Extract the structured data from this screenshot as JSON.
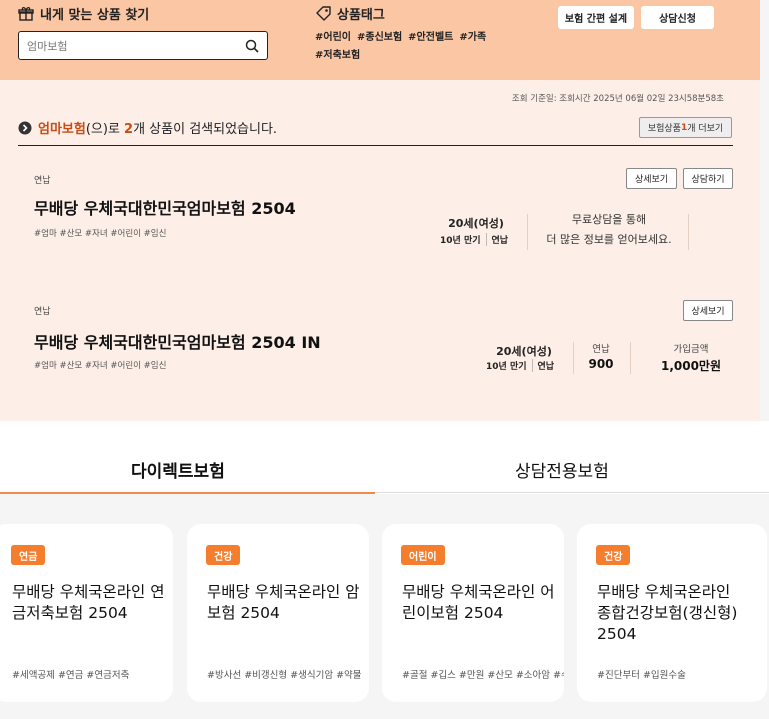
{
  "finder": {
    "title": "내게 맞는 상품 찾기",
    "search_value": "엄마보험"
  },
  "tags": {
    "title": "상품태그",
    "items": [
      "#어린이",
      "#종신보험",
      "#안전벨트",
      "#가족",
      "#저축보험"
    ]
  },
  "header_buttons": {
    "design": "보험 간편 설계",
    "consult": "상담신청"
  },
  "base_time": "조회 기준일: 조회시간 2025년 06월 02일 23시58분58초",
  "result": {
    "query": "엄마보험",
    "suffix1": "(으)로 ",
    "count": "2",
    "suffix2": "개 상품이 검색되었습니다."
  },
  "more_button": {
    "pre": "보험상품 ",
    "count": "1",
    "post": "개 더보기"
  },
  "products": [
    {
      "label": "연납",
      "name": "무배당 우체국대한민국엄마보험 2504",
      "tags": "#엄마 #산모 #자녀 #어린이 #임신",
      "detail_btn": "상세보기",
      "consult_btn": "상담하기",
      "age": "20세(여성)",
      "period": "10년 만기",
      "pay": "연납",
      "consult_line1": "무료상담을 통해",
      "consult_line2": "더 많은 정보를 얻어보세요."
    },
    {
      "label": "연납",
      "name": "무배당 우체국대한민국엄마보험 2504 IN",
      "tags": "#엄마 #산모 #자녀 #어린이 #임신",
      "detail_btn": "상세보기",
      "age": "20세(여성)",
      "period": "10년 만기",
      "pay": "연납",
      "premium_label": "연납",
      "premium_value": "900",
      "amount_label": "가입금액",
      "amount_value": "1,000만원"
    }
  ],
  "tabs": [
    {
      "label": "다이렉트보험",
      "active": true
    },
    {
      "label": "상담전용보험",
      "active": false
    }
  ],
  "cards": [
    {
      "badge": "연금",
      "name": "무배당 우체국온라인 연금저축보험 2504",
      "tags": "#세액공제 #연금 #연금저축"
    },
    {
      "badge": "건강",
      "name": "무배당 우체국온라인 암보험 2504",
      "tags": "#방사선 #비갱신형 #생식기암 #약물"
    },
    {
      "badge": "어린이",
      "name": "무배당 우체국온라인 어린이보험 2504",
      "tags": "#골절 #깁스 #만원 #산모 #소아암 #수"
    },
    {
      "badge": "건강",
      "name": "무배당 우체국온라인 종합건강보험(갱신형) 2504",
      "tags": "#진단부터 #입원수술"
    }
  ],
  "icons": {
    "gift": "gift-icon",
    "search": "search-icon",
    "tag": "tag-icon",
    "chevron": "chevron-right-circle-icon"
  },
  "colors": {
    "accent": "#c84b12",
    "badge": "#f57d2e",
    "header_bg": "#fbc6a4",
    "section_bg": "#fdefe7"
  }
}
